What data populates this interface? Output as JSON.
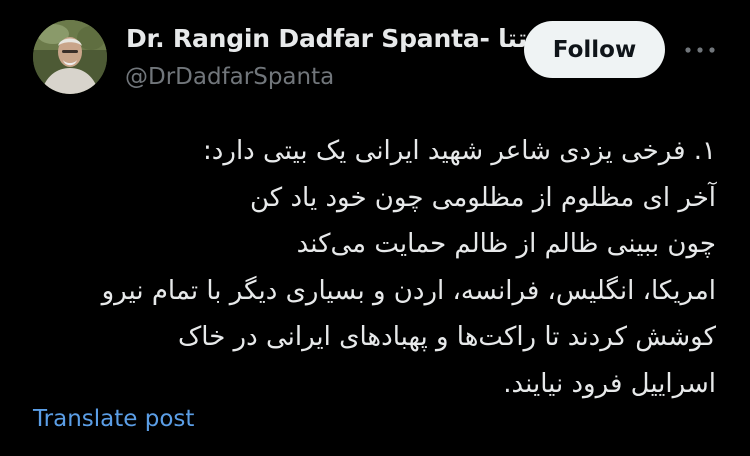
{
  "author": {
    "display_name": "Dr. Rangin Dadfar Spanta- تتا",
    "handle": "@DrDadfarSpanta"
  },
  "actions": {
    "follow_label": "Follow",
    "more_icon": "more-horizontal-icon"
  },
  "post": {
    "lines": [
      "۱. فرخی یزدی شاعر شهید ایرانی یک بیتی دارد:",
      "آخر ای مظلوم از مظلومی چون خود یاد کن",
      "چون ببینی ظالم از ظالم حمایت می‌کند",
      "امریکا، انگلیس، فرانسه، اردن و بسیاری دیگر با تمام نیرو",
      "کوشش کردند تا راکت‌ها و پهبادهای ایرانی در خاک",
      "اسراییل فرود نیایند."
    ]
  },
  "translate": {
    "label": "Translate post"
  },
  "colors": {
    "background": "#000000",
    "text_primary": "#e7e9ea",
    "text_secondary": "#71767b",
    "link": "#5b9ee6",
    "follow_bg": "#eff3f4"
  }
}
